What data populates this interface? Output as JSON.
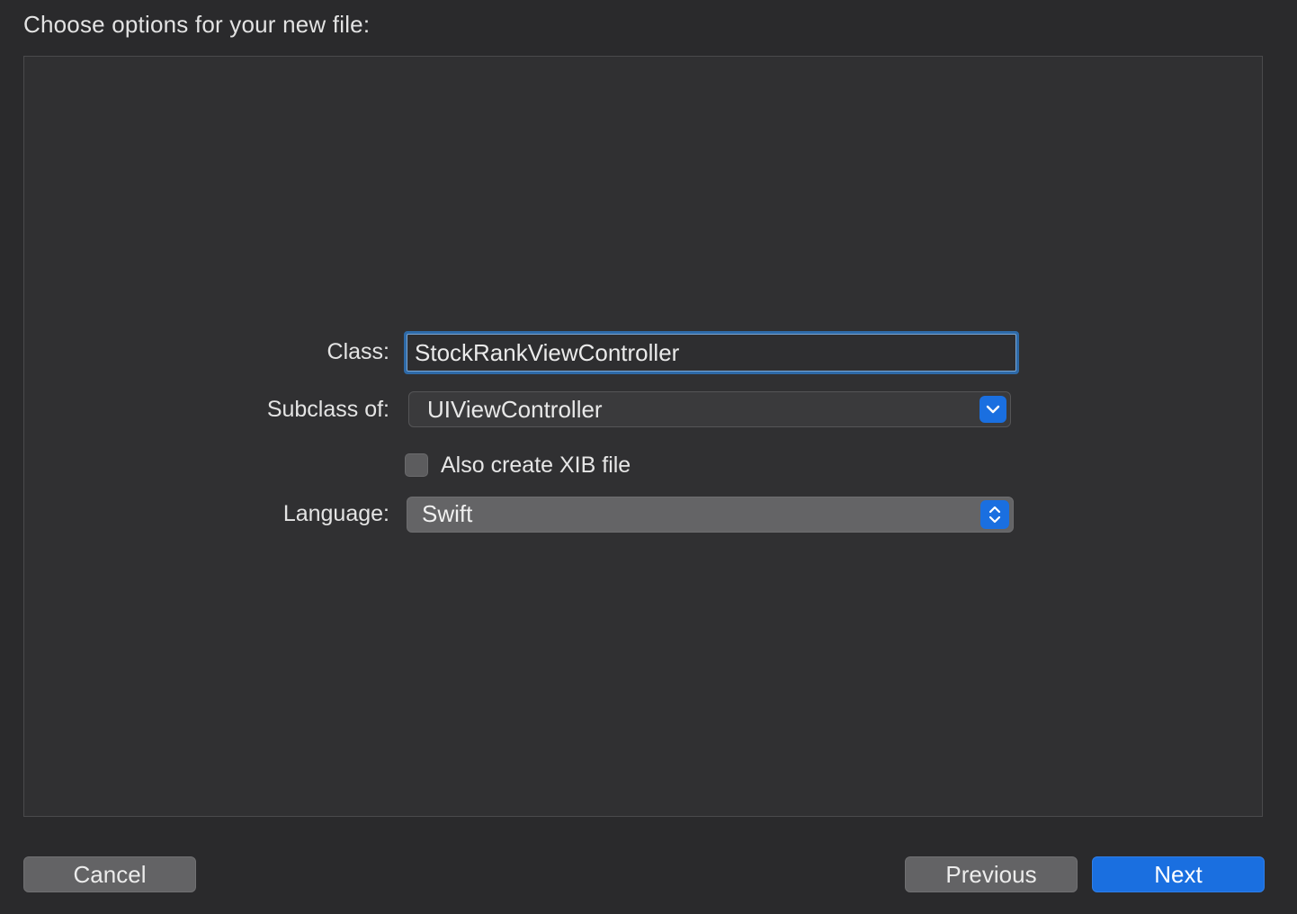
{
  "sheet": {
    "title": "Choose options for your new file:"
  },
  "form": {
    "class_label": "Class:",
    "class_value": "StockRankViewController",
    "subclass_label": "Subclass of:",
    "subclass_value": "UIViewController",
    "xib_checkbox_label": "Also create XIB file",
    "xib_checked": false,
    "language_label": "Language:",
    "language_value": "Swift"
  },
  "buttons": {
    "cancel_label": "Cancel",
    "previous_label": "Previous",
    "next_label": "Next"
  },
  "colors": {
    "accent": "#1a6fe0",
    "focus_ring": "#2e6aa8",
    "background": "#2a2a2c",
    "panel": "#303032"
  },
  "icons": {
    "subclass_popup": "chevron-down-icon",
    "language_popup": "up-down-chevron-icon"
  }
}
